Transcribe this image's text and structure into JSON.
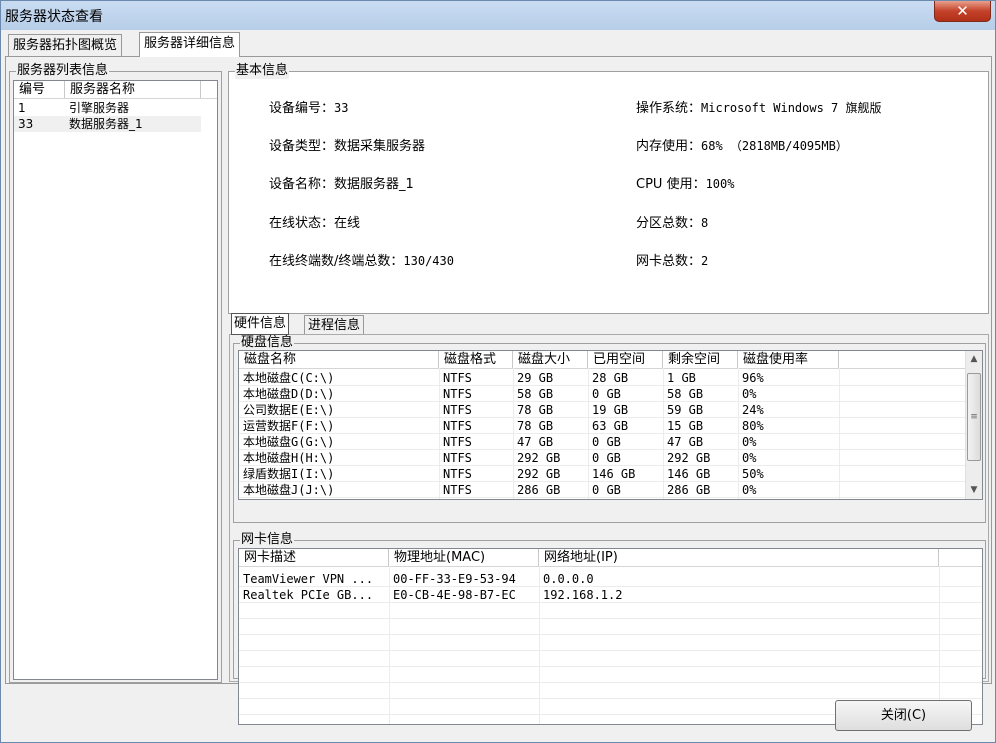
{
  "window": {
    "title": "服务器状态查看",
    "close_glyph": "✕"
  },
  "tabs": [
    {
      "label": "服务器拓扑图概览"
    },
    {
      "label": "服务器详细信息"
    }
  ],
  "server_list": {
    "group_title": "服务器列表信息",
    "columns": [
      "编号",
      "服务器名称"
    ],
    "rows": [
      {
        "id": "1",
        "name": "引擎服务器"
      },
      {
        "id": "33",
        "name": "数据服务器_1"
      }
    ]
  },
  "basic_info": {
    "group_title": "基本信息",
    "left": [
      {
        "label": "设备编号：",
        "value": "33"
      },
      {
        "label": "设备类型：",
        "value": "数据采集服务器"
      },
      {
        "label": "设备名称：",
        "value": "数据服务器_1"
      },
      {
        "label": "在线状态：",
        "value": "在线"
      },
      {
        "label": "在线终端数/终端总数：",
        "value": "130/430"
      }
    ],
    "right": [
      {
        "label": "操作系统：",
        "value": "Microsoft Windows 7 旗舰版"
      },
      {
        "label": "内存使用：",
        "value": "68% （2818MB/4095MB）"
      },
      {
        "label": "CPU 使用：",
        "value": "100%"
      },
      {
        "label": "分区总数：",
        "value": "8"
      },
      {
        "label": "网卡总数：",
        "value": "2"
      }
    ]
  },
  "sub_tabs": [
    {
      "label": "硬件信息"
    },
    {
      "label": "进程信息"
    }
  ],
  "disk_info": {
    "group_title": "硬盘信息",
    "columns": [
      "磁盘名称",
      "磁盘格式",
      "磁盘大小",
      "已用空间",
      "剩余空间",
      "磁盘使用率"
    ],
    "rows": [
      [
        "本地磁盘C(C:\\)",
        "NTFS",
        "29 GB",
        "28 GB",
        "1 GB",
        "96%"
      ],
      [
        "本地磁盘D(D:\\)",
        "NTFS",
        "58 GB",
        "0 GB",
        "58 GB",
        "0%"
      ],
      [
        "公司数据E(E:\\)",
        "NTFS",
        "78 GB",
        "19 GB",
        "59 GB",
        "24%"
      ],
      [
        "运营数据F(F:\\)",
        "NTFS",
        "78 GB",
        "63 GB",
        "15 GB",
        "80%"
      ],
      [
        "本地磁盘G(G:\\)",
        "NTFS",
        "47 GB",
        "0 GB",
        "47 GB",
        "0%"
      ],
      [
        "本地磁盘H(H:\\)",
        "NTFS",
        "292 GB",
        "0 GB",
        "292 GB",
        "0%"
      ],
      [
        "绿盾数据I(I:\\)",
        "NTFS",
        "292 GB",
        "146 GB",
        "146 GB",
        "50%"
      ],
      [
        "本地磁盘J(J:\\)",
        "NTFS",
        "286 GB",
        "0 GB",
        "286 GB",
        "0%"
      ]
    ]
  },
  "nic_info": {
    "group_title": "网卡信息",
    "columns": [
      "网卡描述",
      "物理地址(MAC)",
      "网络地址(IP)"
    ],
    "rows": [
      [
        "TeamViewer VPN ...",
        "00-FF-33-E9-53-94",
        "0.0.0.0"
      ],
      [
        "Realtek PCIe GB...",
        "E0-CB-4E-98-B7-EC",
        "192.168.1.2"
      ]
    ]
  },
  "buttons": {
    "close_label": "关闭(C)"
  },
  "icons": {
    "scroll_up": "▲",
    "scroll_down": "▼",
    "scroll_grip": "≡"
  }
}
